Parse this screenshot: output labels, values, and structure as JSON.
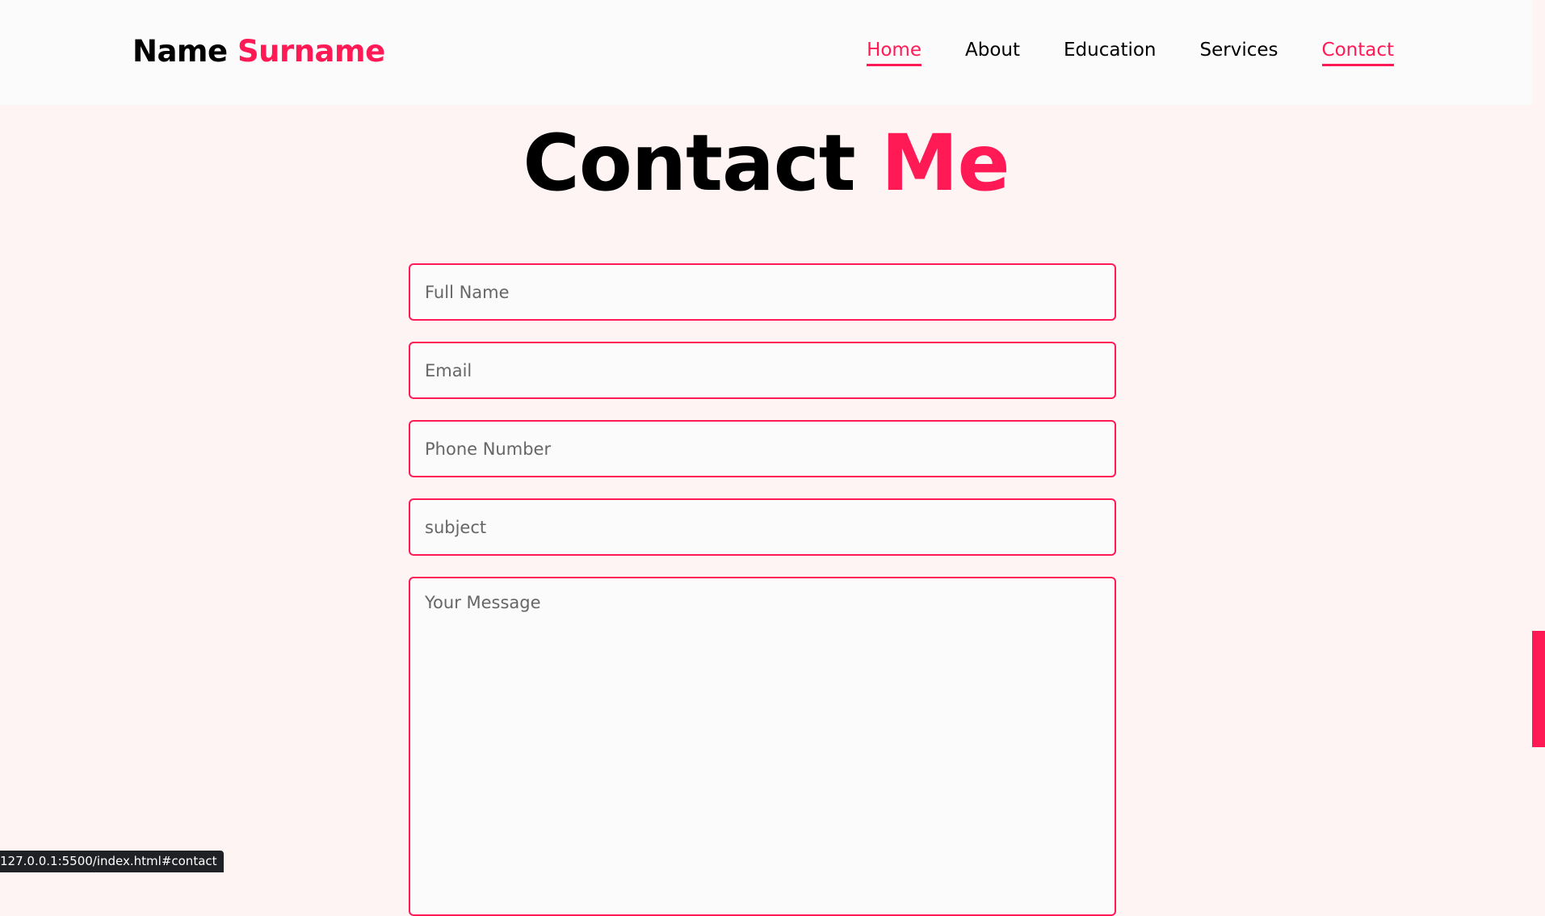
{
  "header": {
    "logo_name": "Name",
    "logo_surname": "Surname",
    "nav": [
      {
        "label": "Home",
        "active": true
      },
      {
        "label": "About",
        "active": false
      },
      {
        "label": "Education",
        "active": false
      },
      {
        "label": "Services",
        "active": false
      },
      {
        "label": "Contact",
        "active": true
      }
    ]
  },
  "section": {
    "title_main": "Contact",
    "title_accent": "Me"
  },
  "form": {
    "full_name_placeholder": "Full Name",
    "email_placeholder": "Email",
    "phone_placeholder": "Phone Number",
    "subject_placeholder": "subject",
    "message_placeholder": "Your Message"
  },
  "status_bar": {
    "url": "127.0.0.1:5500/index.html#contact"
  },
  "colors": {
    "accent": "#ff1a55",
    "background": "#fff4f4",
    "header_bg": "#fcfbfb"
  }
}
